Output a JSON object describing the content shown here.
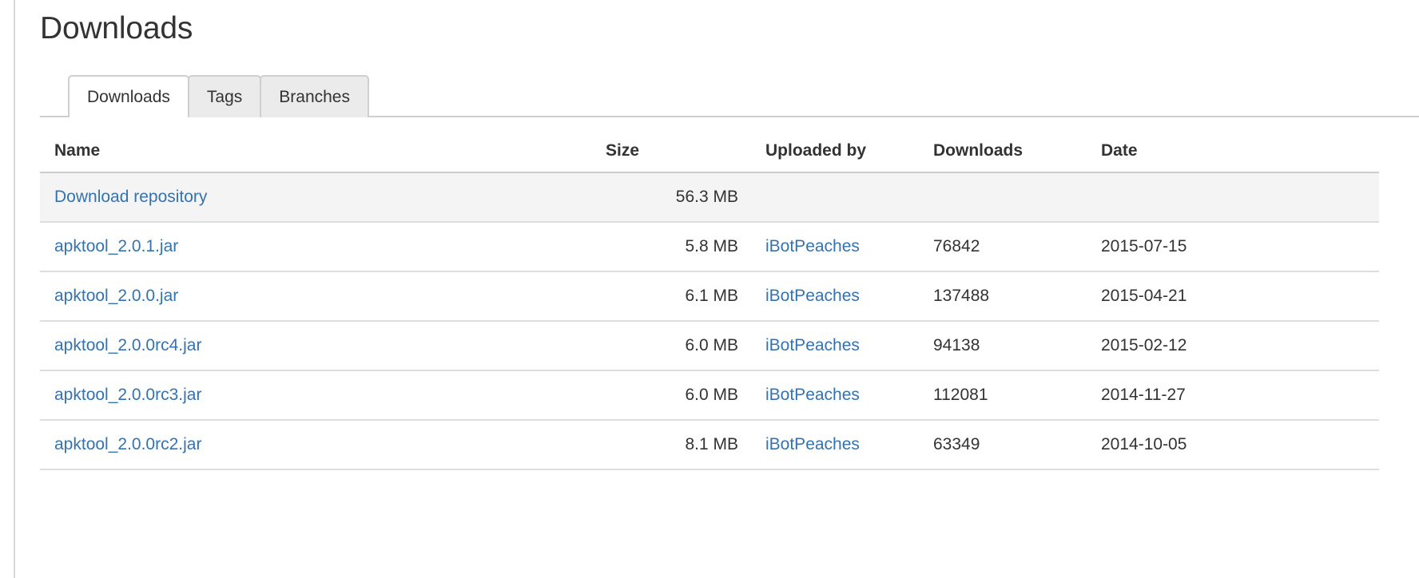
{
  "page": {
    "title": "Downloads"
  },
  "tabs": [
    {
      "label": "Downloads",
      "active": true
    },
    {
      "label": "Tags",
      "active": false
    },
    {
      "label": "Branches",
      "active": false
    }
  ],
  "table": {
    "columns": {
      "name": "Name",
      "size": "Size",
      "uploaded_by": "Uploaded by",
      "downloads": "Downloads",
      "date": "Date"
    },
    "rows": [
      {
        "name": "Download repository",
        "size": "56.3 MB",
        "uploaded_by": "",
        "downloads": "",
        "date": "",
        "highlight": true
      },
      {
        "name": "apktool_2.0.1.jar",
        "size": "5.8 MB",
        "uploaded_by": "iBotPeaches",
        "downloads": "76842",
        "date": "2015-07-15",
        "highlight": false
      },
      {
        "name": "apktool_2.0.0.jar",
        "size": "6.1 MB",
        "uploaded_by": "iBotPeaches",
        "downloads": "137488",
        "date": "2015-04-21",
        "highlight": false
      },
      {
        "name": "apktool_2.0.0rc4.jar",
        "size": "6.0 MB",
        "uploaded_by": "iBotPeaches",
        "downloads": "94138",
        "date": "2015-02-12",
        "highlight": false
      },
      {
        "name": "apktool_2.0.0rc3.jar",
        "size": "6.0 MB",
        "uploaded_by": "iBotPeaches",
        "downloads": "112081",
        "date": "2014-11-27",
        "highlight": false
      },
      {
        "name": "apktool_2.0.0rc2.jar",
        "size": "8.1 MB",
        "uploaded_by": "iBotPeaches",
        "downloads": "63349",
        "date": "2014-10-05",
        "highlight": false
      }
    ]
  },
  "colors": {
    "link": "#3572b0",
    "text": "#333333",
    "row_highlight": "#f4f4f4",
    "tab_inactive": "#ebebeb",
    "border": "#cccccc"
  }
}
